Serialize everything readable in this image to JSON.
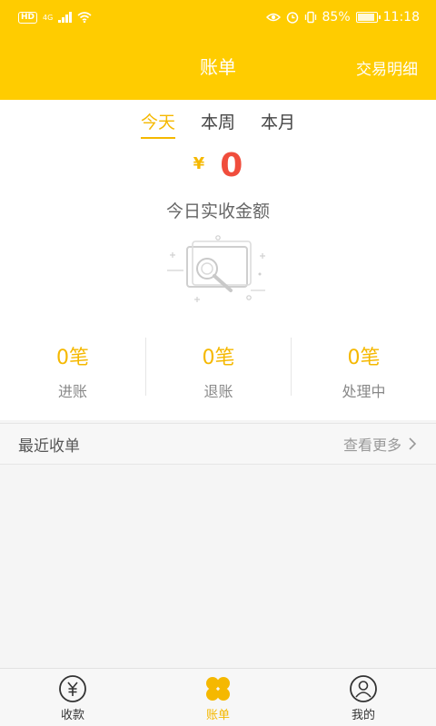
{
  "status_bar": {
    "network_badge": "HD",
    "network_type": "4G",
    "battery_text": "85%",
    "time": "11:18"
  },
  "header": {
    "title": "账单",
    "right_action": "交易明细"
  },
  "period_tabs": [
    {
      "label": "今天",
      "active": true
    },
    {
      "label": "本周",
      "active": false
    },
    {
      "label": "本月",
      "active": false
    }
  ],
  "summary": {
    "currency_symbol": "¥",
    "amount": "0",
    "amount_label": "今日实收金额"
  },
  "stats": [
    {
      "value": "0笔",
      "label": "进账"
    },
    {
      "value": "0笔",
      "label": "退账"
    },
    {
      "value": "0笔",
      "label": "处理中"
    }
  ],
  "recent": {
    "title": "最近收单",
    "more_label": "查看更多"
  },
  "bottom_nav": [
    {
      "label": "收款",
      "icon": "yuan-circle-icon",
      "active": false
    },
    {
      "label": "账单",
      "icon": "four-petal-icon",
      "active": true
    },
    {
      "label": "我的",
      "icon": "user-circle-icon",
      "active": false
    }
  ],
  "colors": {
    "brand": "#ffcc00",
    "accent": "#f5b800",
    "amount": "#f04d3c"
  }
}
